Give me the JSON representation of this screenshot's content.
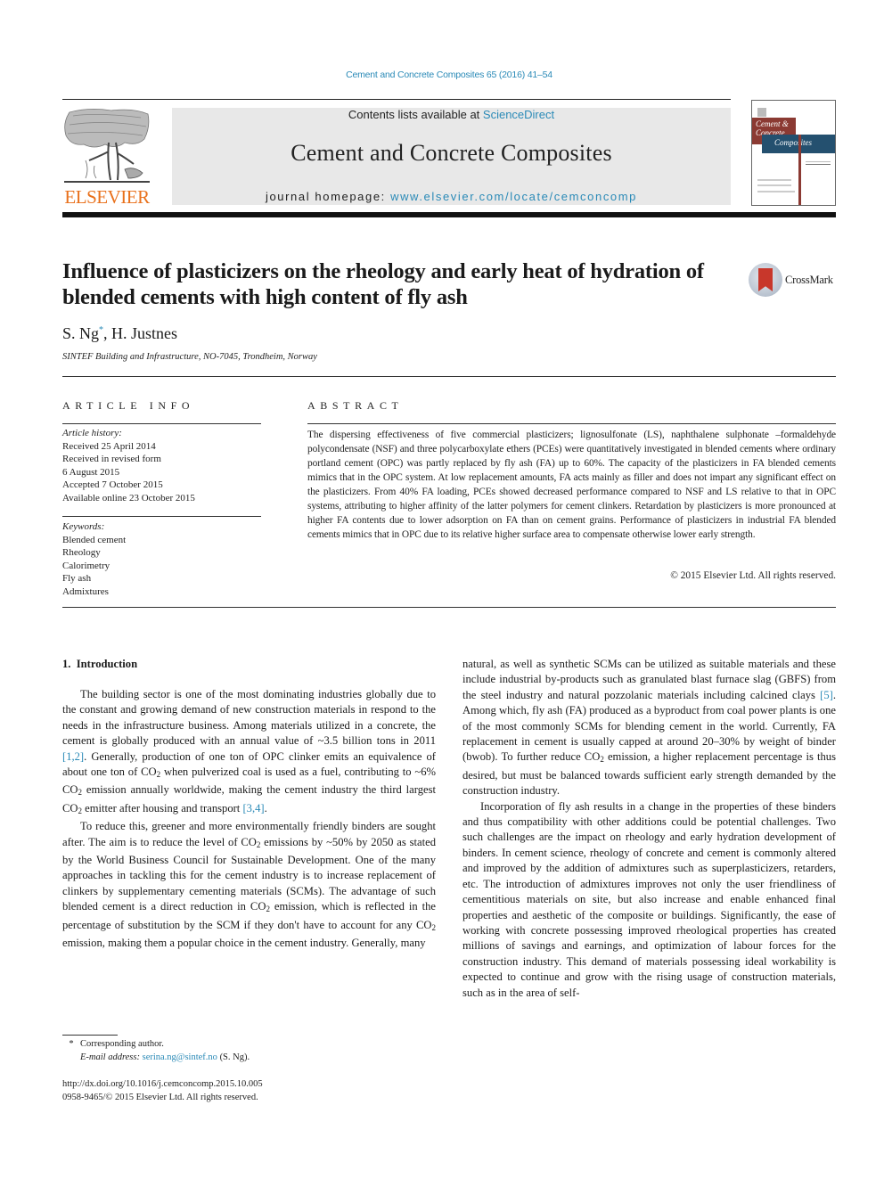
{
  "header": {
    "citation": "Cement and Concrete Composites 65 (2016) 41–54",
    "publisher_logo_text": "ELSEVIER",
    "contents_prefix": "Contents lists available at ",
    "contents_link": "ScienceDirect",
    "journal_title": "Cement and Concrete Composites",
    "homepage_prefix": "journal homepage: ",
    "homepage_link": "www.elsevier.com/locate/cemconcomp",
    "cover": {
      "line1": "Cement &",
      "line2": "Concrete",
      "line3": "Composites"
    },
    "colors": {
      "link": "#2a8ab7",
      "elsevier_orange": "#e9711c",
      "masthead_bg": "#e8e8e8",
      "cover_red": "#8b3a33",
      "cover_blue": "#24506f"
    }
  },
  "article": {
    "title": "Influence of plasticizers on the rheology and early heat of hydration of blended cements with high content of fly ash",
    "crossmark_label": "CrossMark",
    "authors": [
      {
        "name": "S. Ng",
        "mark": "*"
      },
      {
        "name": "H. Justnes",
        "mark": ""
      }
    ],
    "author_separator": ", ",
    "affiliation": "SINTEF Building and Infrastructure, NO-7045, Trondheim, Norway"
  },
  "article_info": {
    "heading": "ARTICLE INFO",
    "history_heading": "Article history:",
    "history": [
      "Received 25 April 2014",
      "Received in revised form",
      "6 August 2015",
      "Accepted 7 October 2015",
      "Available online 23 October 2015"
    ],
    "keywords_heading": "Keywords:",
    "keywords": [
      "Blended cement",
      "Rheology",
      "Calorimetry",
      "Fly ash",
      "Admixtures"
    ]
  },
  "abstract": {
    "heading": "ABSTRACT",
    "text": "The dispersing effectiveness of five commercial plasticizers; lignosulfonate (LS), naphthalene sulphonate –formaldehyde polycondensate (NSF) and three polycarboxylate ethers (PCEs) were quantitatively investigated in blended cements where ordinary portland cement (OPC) was partly replaced by fly ash (FA) up to 60%. The capacity of the plasticizers in FA blended cements mimics that in the OPC system. At low replacement amounts, FA acts mainly as filler and does not impart any significant effect on the plasticizers. From 40% FA loading, PCEs showed decreased performance compared to NSF and LS relative to that in OPC systems, attributing to higher affinity of the latter polymers for cement clinkers. Retardation by plasticizers is more pronounced at higher FA contents due to lower adsorption on FA than on cement grains. Performance of plasticizers in industrial FA blended cements mimics that in OPC due to its relative higher surface area to compensate otherwise lower early strength.",
    "copyright": "© 2015 Elsevier Ltd. All rights reserved."
  },
  "body": {
    "section_heading": "1. Introduction",
    "left_col": {
      "p1": {
        "t1": "The building sector is one of the most dominating industries globally due to the constant and growing demand of new con­struction materials in respond to the needs in the infrastructure business. Among materials utilized in a concrete, the cement is globally produced with an annual value of ~3.5 billion tons in 2011 ",
        "ref1": "[1,2]",
        "t2": ". Generally, production of one ton of OPC clinker emits an equivalence of about one ton of CO",
        "t3": " when pulverized coal is used as a fuel, contributing to ~6% CO",
        "t4": " emission annually worldwide, making the cement industry the third largest CO",
        "t5": " emitter after housing and transport ",
        "ref2": "[3,4]",
        "t6": "."
      },
      "p2": {
        "t1": "To reduce this, greener and more environmentally friendly binders are sought after. The aim is to reduce the level of CO",
        "t2": " emissions by ~50% by 2050 as stated by the World Business Council for Sustainable Development. One of the many approaches in tackling this for the cement industry is to increase replacement of clinkers by supplementary cementing materials (SCMs). The advantage of such blended cement is a direct reduction in CO",
        "t3": " emission, which is reflected in the percentage of substitution by the SCM if they don't have to account for any CO",
        "t4": " emission, making them a popular choice in the cement industry. Generally, many"
      }
    },
    "right_col": {
      "p1": {
        "t1": "natural, as well as synthetic SCMs can be utilized as suitable ma­terials and these include industrial by-products such as granulated blast furnace slag (GBFS) from the steel industry and natural pozzolanic materials including calcined clays ",
        "ref1": "[5]",
        "t2": ". Among which, fly ash (FA) produced as a byproduct from coal power plants is one of the most commonly SCMs for blending cement in the world. Currently, FA replacement in cement is usually capped at around 20–30% by weight of binder (bwob). To further reduce CO",
        "t3": " emis­sion, a higher replacement percentage is thus desired, but must be balanced towards sufficient early strength demanded by the con­struction industry."
      },
      "p2": "Incorporation of fly ash results in a change in the properties of these binders and thus compatibility with other additions could be potential challenges. Two such challenges are the impact on rheology and early hydration development of binders. In cement science, rheology of concrete and cement is commonly altered and improved by the addition of admixtures such as superplasticizers, retarders, etc. The introduction of admixtures improves not only the user friendliness of cementitious materials on site, but also increase and enable enhanced final properties and aesthetic of the composite or buildings. Significantly, the ease of working with concrete possessing improved rheological properties has created millions of savings and earnings, and optimization of labour forces for the construction industry. This demand of materials possessing ideal workability is expected to continue and grow with the rising usage of construction materials, such as in the area of self-"
    },
    "subscript_2": "2"
  },
  "footnotes": {
    "marker": "*",
    "corresponding": "Corresponding author.",
    "email_label": "E-mail address: ",
    "email": "serina.ng@sintef.no",
    "email_suffix": " (S. Ng).",
    "doi": "http://dx.doi.org/10.1016/j.cemconcomp.2015.10.005",
    "issn_copyright": "0958-9465/© 2015 Elsevier Ltd. All rights reserved."
  }
}
